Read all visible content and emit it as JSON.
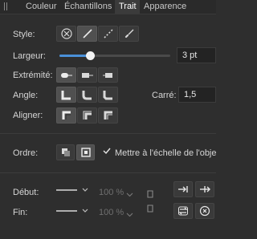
{
  "tabs": [
    {
      "label": "Couleur"
    },
    {
      "label": "Échantillons"
    },
    {
      "label": "Trait"
    },
    {
      "label": "Apparence"
    }
  ],
  "style": {
    "label": "Style:"
  },
  "width": {
    "label": "Largeur:",
    "value": "3 pt",
    "slider_fraction": 0.27
  },
  "caps": {
    "label": "Extrémité:"
  },
  "corner": {
    "label": "Angle:",
    "miter_label": "Carré:",
    "miter_value": "1,5"
  },
  "align": {
    "label": "Aligner:"
  },
  "order": {
    "label": "Ordre:",
    "scale_label": "Mettre à l'échelle de l'obje"
  },
  "arrows": {
    "start_label": "Début:",
    "end_label": "Fin:",
    "start_percent": "100 %",
    "end_percent": "100 %"
  },
  "colors": {
    "accent": "#4a90d9",
    "background": "#2e2e2e"
  }
}
